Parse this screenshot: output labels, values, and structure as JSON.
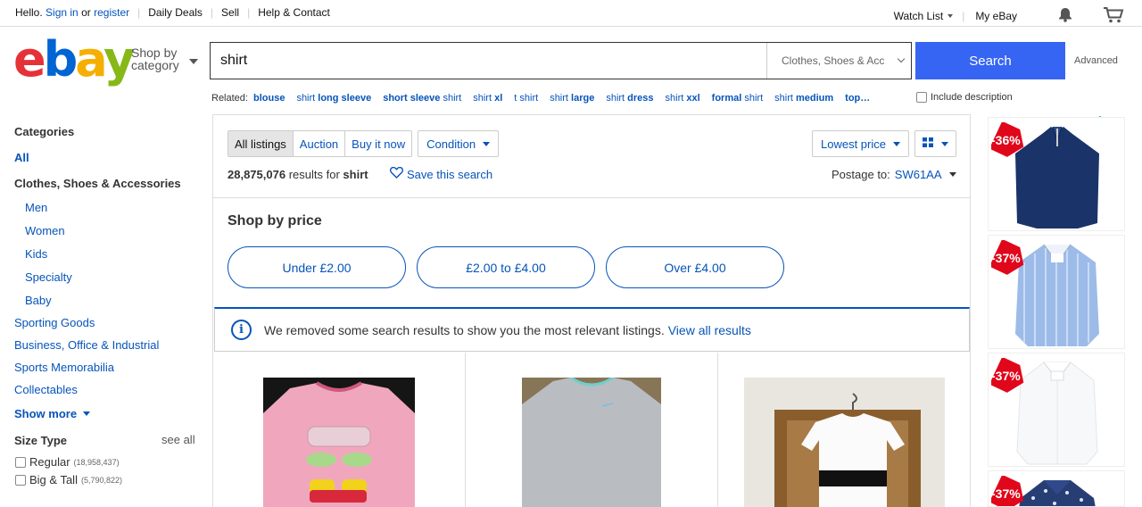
{
  "topbar": {
    "hello": "Hello.",
    "sign_in": "Sign in",
    "or": "or",
    "register": "register",
    "daily_deals": "Daily Deals",
    "sell": "Sell",
    "help": "Help & Contact",
    "watch_list": "Watch List",
    "my_ebay": "My eBay"
  },
  "header": {
    "logo": [
      "e",
      "b",
      "a",
      "y"
    ],
    "shop_by_1": "Shop by",
    "shop_by_2": "category",
    "search_value": "shirt",
    "category": "Clothes, Shoes & Acc",
    "search_button": "Search",
    "advanced": "Advanced"
  },
  "related": {
    "label": "Related:",
    "items": [
      {
        "bold": "blouse",
        "rest": ""
      },
      {
        "pre": "shirt ",
        "bold": "long sleeve",
        "rest": ""
      },
      {
        "pre": "",
        "bold": "short sleeve",
        "rest": " shirt"
      },
      {
        "pre": "shirt ",
        "bold": "xl",
        "rest": ""
      },
      {
        "pre": "",
        "bold": "t",
        "rest": " shirt"
      },
      {
        "pre": "shirt ",
        "bold": "large",
        "rest": ""
      },
      {
        "pre": "shirt ",
        "bold": "dress",
        "rest": ""
      },
      {
        "pre": "shirt ",
        "bold": "xxl",
        "rest": ""
      },
      {
        "pre": "",
        "bold": "formal",
        "rest": " shirt"
      },
      {
        "pre": "shirt ",
        "bold": "medium",
        "rest": ""
      },
      {
        "pre": "",
        "bold": "top…",
        "rest": ""
      }
    ],
    "include_description": "Include description"
  },
  "sidebar": {
    "categories": "Categories",
    "all": "All",
    "clothes": "Clothes, Shoes & Accessories",
    "subs": [
      "Men",
      "Women",
      "Kids",
      "Specialty",
      "Baby"
    ],
    "tops": [
      "Sporting Goods",
      "Business, Office & Industrial",
      "Sports Memorabilia",
      "Collectables"
    ],
    "show_more": "Show more",
    "size_type": "Size Type",
    "see_all": "see all",
    "sizes": [
      {
        "label": "Regular",
        "count": "(18,958,437)"
      },
      {
        "label": "Big & Tall",
        "count": "(5,790,822)"
      }
    ]
  },
  "main": {
    "tabs": [
      "All listings",
      "Auction",
      "Buy it now"
    ],
    "condition": "Condition",
    "sort": "Lowest price",
    "count": "28,875,076",
    "results_for": "results for",
    "query": "shirt",
    "save_search": "Save this search",
    "postage_to": "Postage to:",
    "postcode": "SW61AA",
    "shop_by_price": "Shop by price",
    "price_pills": [
      "Under £2.00",
      "£2.00 to £4.00",
      "Over £4.00"
    ],
    "notice": "We removed some search results to show you the most relevant listings.",
    "view_all": "View all results"
  },
  "ads": {
    "discounts": [
      "-36%",
      "-37%",
      "-37%",
      "-37%"
    ]
  },
  "colors": {
    "link": "#0654ba",
    "search_button": "#3665f3",
    "badge": "#e0071b"
  }
}
